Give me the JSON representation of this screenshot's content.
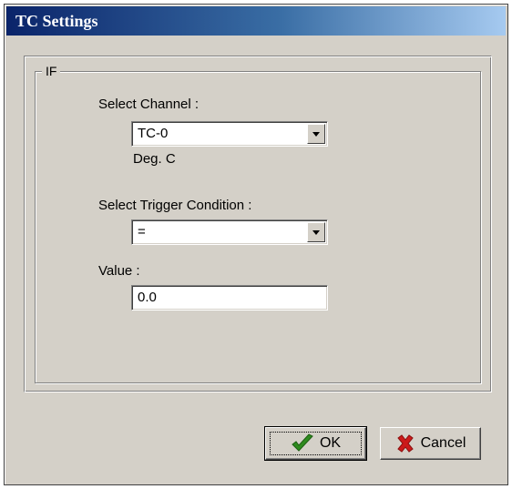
{
  "window": {
    "title": "TC Settings"
  },
  "group": {
    "label": "IF"
  },
  "channel": {
    "label": "Select Channel :",
    "selected": "TC-0",
    "unit": "Deg. C"
  },
  "trigger": {
    "label": "Select Trigger Condition :",
    "selected": "="
  },
  "value": {
    "label": "Value :",
    "text": "0.0"
  },
  "buttons": {
    "ok_label": "OK",
    "cancel_label": "Cancel"
  },
  "icons": {
    "ok": "checkmark-icon",
    "cancel": "x-mark-icon",
    "dropdown": "chevron-down-icon"
  },
  "colors": {
    "check_green": "#2e8b1e",
    "cancel_red": "#cc1a1a",
    "title_bar_start": "#0a246a",
    "title_bar_end": "#a6caf0",
    "dialog_bg": "#d4d0c8"
  }
}
